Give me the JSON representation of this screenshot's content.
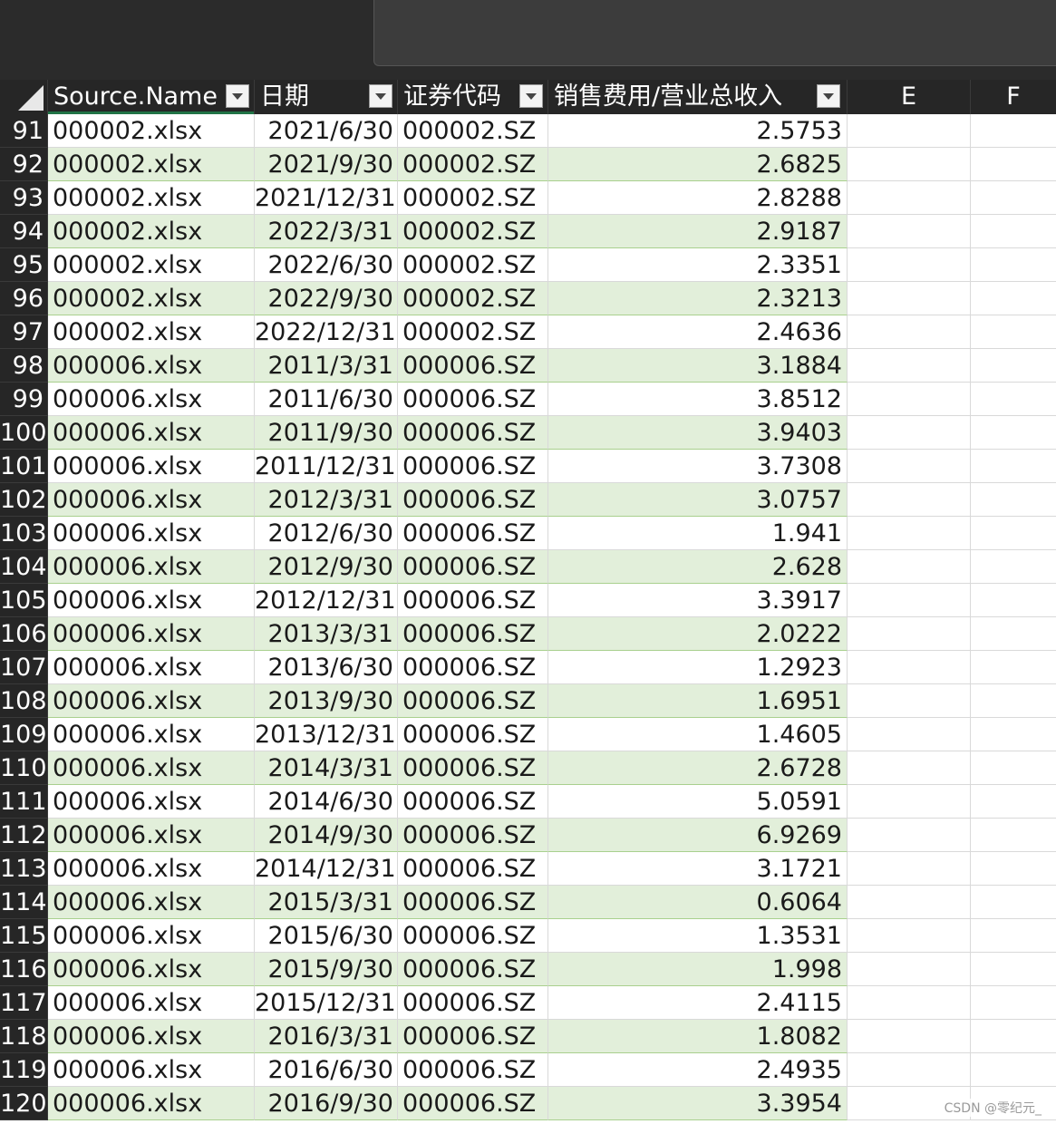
{
  "columns": {
    "a": "Source.Name",
    "b": "日期",
    "c": "证券代码",
    "d": "销售费用/营业总收入",
    "e": "E",
    "f": "F"
  },
  "rows": [
    {
      "n": "91",
      "src": "000002.xlsx",
      "date": "2021/6/30",
      "code": "000002.SZ",
      "val": "2.5753"
    },
    {
      "n": "92",
      "src": "000002.xlsx",
      "date": "2021/9/30",
      "code": "000002.SZ",
      "val": "2.6825"
    },
    {
      "n": "93",
      "src": "000002.xlsx",
      "date": "2021/12/31",
      "code": "000002.SZ",
      "val": "2.8288"
    },
    {
      "n": "94",
      "src": "000002.xlsx",
      "date": "2022/3/31",
      "code": "000002.SZ",
      "val": "2.9187"
    },
    {
      "n": "95",
      "src": "000002.xlsx",
      "date": "2022/6/30",
      "code": "000002.SZ",
      "val": "2.3351"
    },
    {
      "n": "96",
      "src": "000002.xlsx",
      "date": "2022/9/30",
      "code": "000002.SZ",
      "val": "2.3213"
    },
    {
      "n": "97",
      "src": "000002.xlsx",
      "date": "2022/12/31",
      "code": "000002.SZ",
      "val": "2.4636"
    },
    {
      "n": "98",
      "src": "000006.xlsx",
      "date": "2011/3/31",
      "code": "000006.SZ",
      "val": "3.1884"
    },
    {
      "n": "99",
      "src": "000006.xlsx",
      "date": "2011/6/30",
      "code": "000006.SZ",
      "val": "3.8512"
    },
    {
      "n": "100",
      "src": "000006.xlsx",
      "date": "2011/9/30",
      "code": "000006.SZ",
      "val": "3.9403"
    },
    {
      "n": "101",
      "src": "000006.xlsx",
      "date": "2011/12/31",
      "code": "000006.SZ",
      "val": "3.7308"
    },
    {
      "n": "102",
      "src": "000006.xlsx",
      "date": "2012/3/31",
      "code": "000006.SZ",
      "val": "3.0757"
    },
    {
      "n": "103",
      "src": "000006.xlsx",
      "date": "2012/6/30",
      "code": "000006.SZ",
      "val": "1.941"
    },
    {
      "n": "104",
      "src": "000006.xlsx",
      "date": "2012/9/30",
      "code": "000006.SZ",
      "val": "2.628"
    },
    {
      "n": "105",
      "src": "000006.xlsx",
      "date": "2012/12/31",
      "code": "000006.SZ",
      "val": "3.3917"
    },
    {
      "n": "106",
      "src": "000006.xlsx",
      "date": "2013/3/31",
      "code": "000006.SZ",
      "val": "2.0222"
    },
    {
      "n": "107",
      "src": "000006.xlsx",
      "date": "2013/6/30",
      "code": "000006.SZ",
      "val": "1.2923"
    },
    {
      "n": "108",
      "src": "000006.xlsx",
      "date": "2013/9/30",
      "code": "000006.SZ",
      "val": "1.6951"
    },
    {
      "n": "109",
      "src": "000006.xlsx",
      "date": "2013/12/31",
      "code": "000006.SZ",
      "val": "1.4605"
    },
    {
      "n": "110",
      "src": "000006.xlsx",
      "date": "2014/3/31",
      "code": "000006.SZ",
      "val": "2.6728"
    },
    {
      "n": "111",
      "src": "000006.xlsx",
      "date": "2014/6/30",
      "code": "000006.SZ",
      "val": "5.0591"
    },
    {
      "n": "112",
      "src": "000006.xlsx",
      "date": "2014/9/30",
      "code": "000006.SZ",
      "val": "6.9269"
    },
    {
      "n": "113",
      "src": "000006.xlsx",
      "date": "2014/12/31",
      "code": "000006.SZ",
      "val": "3.1721"
    },
    {
      "n": "114",
      "src": "000006.xlsx",
      "date": "2015/3/31",
      "code": "000006.SZ",
      "val": "0.6064"
    },
    {
      "n": "115",
      "src": "000006.xlsx",
      "date": "2015/6/30",
      "code": "000006.SZ",
      "val": "1.3531"
    },
    {
      "n": "116",
      "src": "000006.xlsx",
      "date": "2015/9/30",
      "code": "000006.SZ",
      "val": "1.998"
    },
    {
      "n": "117",
      "src": "000006.xlsx",
      "date": "2015/12/31",
      "code": "000006.SZ",
      "val": "2.4115"
    },
    {
      "n": "118",
      "src": "000006.xlsx",
      "date": "2016/3/31",
      "code": "000006.SZ",
      "val": "1.8082"
    },
    {
      "n": "119",
      "src": "000006.xlsx",
      "date": "2016/6/30",
      "code": "000006.SZ",
      "val": "2.4935"
    },
    {
      "n": "120",
      "src": "000006.xlsx",
      "date": "2016/9/30",
      "code": "000006.SZ",
      "val": "3.3954"
    }
  ],
  "watermark": "CSDN @零纪元_",
  "icons": {
    "filter": "filter-dropdown-icon",
    "select_all": "select-all-corner-icon"
  },
  "colors": {
    "band": "#e2efda",
    "header_bg": "#262626",
    "accent": "#217346"
  }
}
